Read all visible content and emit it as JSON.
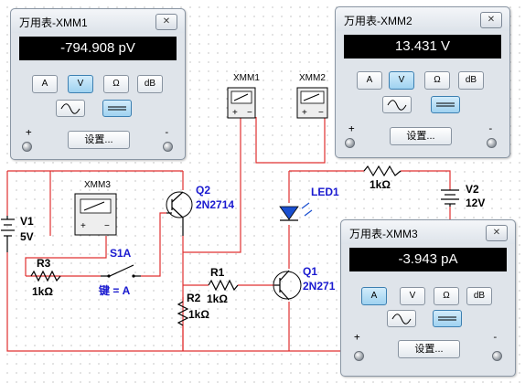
{
  "schematic": {
    "labels": {
      "xmm1": "XMM1",
      "xmm2": "XMM2",
      "xmm3": "XMM3",
      "q2_ref": "Q2",
      "q2_model": "2N2714",
      "q1_ref": "Q1",
      "q1_model": "2N271",
      "led_ref": "LED1",
      "v1_ref": "V1",
      "v1_val": "5V",
      "v2_ref": "V2",
      "v2_val": "12V",
      "r1_ref": "R1",
      "r1_val": "1kΩ",
      "r2_ref": "R2",
      "r2_val": "1kΩ",
      "r3_ref": "R3",
      "r3_val": "1kΩ",
      "r4_val": "1kΩ",
      "s1_ref": "S1A",
      "s1_key": "键 = A"
    },
    "colors": {
      "wire": "#e03030",
      "label_blue": "#1a1ad0"
    }
  },
  "meters": [
    {
      "title": "万用表-XMM1",
      "close_glyph": "✕",
      "reading": "-794.908 pV",
      "buttons": [
        "A",
        "V",
        "Ω",
        "dB"
      ],
      "active_button": "V",
      "active_wave": "dc",
      "settings_label": "设置...",
      "plus": "+",
      "minus": "-"
    },
    {
      "title": "万用表-XMM2",
      "close_glyph": "✕",
      "reading": "13.431 V",
      "buttons": [
        "A",
        "V",
        "Ω",
        "dB"
      ],
      "active_button": "V",
      "active_wave": "dc",
      "settings_label": "设置...",
      "plus": "+",
      "minus": "-"
    },
    {
      "title": "万用表-XMM3",
      "close_glyph": "✕",
      "reading": "-3.943 pA",
      "buttons": [
        "A",
        "V",
        "Ω",
        "dB"
      ],
      "active_button": "A",
      "active_wave": "dc",
      "settings_label": "设置...",
      "plus": "+",
      "minus": "-"
    }
  ]
}
